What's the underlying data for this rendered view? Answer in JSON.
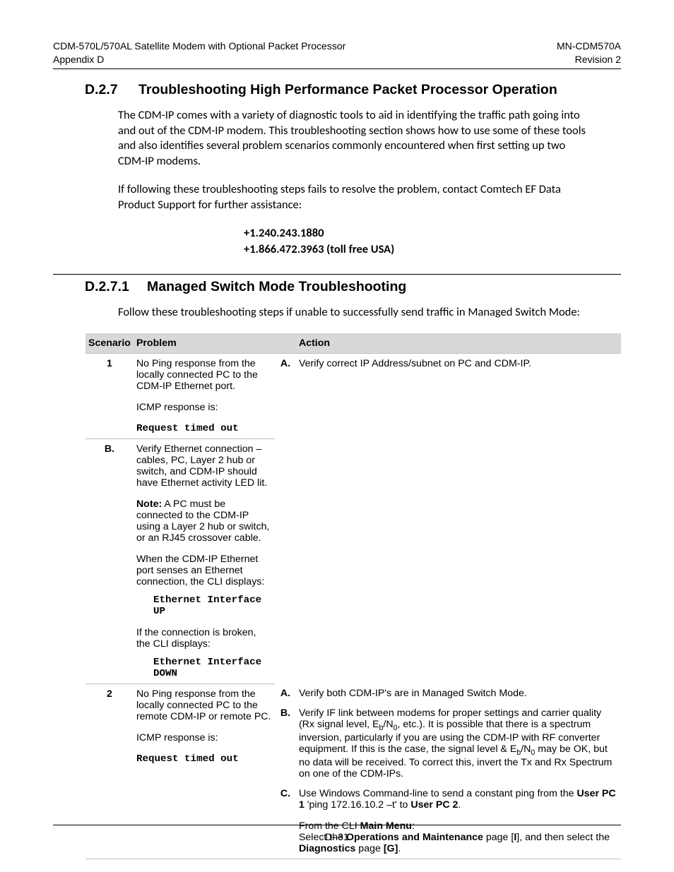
{
  "header": {
    "left_line1": "CDM-570L/570AL Satellite Modem with Optional Packet Processor",
    "left_line2": "Appendix D",
    "right_line1": "MN-CDM570A",
    "right_line2": "Revision 2"
  },
  "section_d27": {
    "num": "D.2.7",
    "title": "Troubleshooting High Performance Packet Processor Operation",
    "p1": "The CDM-IP comes with a variety of diagnostic tools to aid in identifying the traffic path going into and out of the CDM-IP modem. This troubleshooting section shows how to use some of these tools and also identifies several problem scenarios commonly encountered when first setting up two CDM-IP modems.",
    "p2": "If following these troubleshooting steps fails to resolve the problem, contact Comtech EF Data Product Support for further assistance:",
    "phone1": "+1.240.243.1880",
    "phone2": "+1.866.472.3963 (toll free USA)"
  },
  "section_d271": {
    "num": "D.2.7.1",
    "title": "Managed Switch Mode Troubleshooting",
    "p1": "Follow these troubleshooting steps if unable to successfully send traffic in Managed Switch Mode:"
  },
  "table": {
    "headers": {
      "scenario": "Scenario",
      "problem": "Problem",
      "action": "Action"
    },
    "row1": {
      "scenario": "1",
      "problem_l1": "No Ping response from the locally connected PC to the CDM-IP Ethernet port.",
      "problem_l2": "ICMP response is:",
      "problem_code": "Request timed out",
      "a_letter": "A.",
      "a_text": "Verify correct IP Address/subnet on PC and CDM-IP.",
      "b_letter": "B.",
      "b_text": "Verify Ethernet connection – cables, PC, Layer 2 hub or switch, and CDM-IP should have Ethernet activity LED lit.",
      "note_label": "Note:",
      "note_text": " A PC must be connected to the CDM-IP using a Layer 2 hub or switch, or an RJ45 crossover cable.",
      "sense_text": "When the CDM-IP Ethernet port senses an Ethernet connection, the CLI displays:",
      "code_up": "Ethernet Interface UP",
      "broken_text": "If the connection is broken, the CLI displays:",
      "code_down": "Ethernet Interface DOWN"
    },
    "row2": {
      "scenario": "2",
      "problem_l1": "No Ping response from the locally connected PC to the remote CDM-IP or remote PC.",
      "problem_l2": "ICMP response is:",
      "problem_code": "Request timed out",
      "a_letter": "A.",
      "a_text": "Verify both CDM-IP's are in Managed Switch Mode.",
      "b_letter": "B.",
      "c_letter": "C.",
      "c_pre": "Use Windows Command-line to send a constant ping from the ",
      "c_user1": "User PC 1",
      "c_mid": " 'ping 172.16.10.2 –t' to ",
      "c_user2": "User PC 2",
      "c_post": ".",
      "cli_from": "From the CLI ",
      "cli_main": "Main Menu",
      "cli_colon": ":",
      "cli_select": "Select the  ",
      "cli_ops": "Operations and Maintenance",
      "cli_page_i": " page [",
      "cli_i": "I",
      "cli_then": "], and then select the ",
      "cli_diag": "Diagnostics",
      "cli_page_g": " page ",
      "cli_g": "[G]",
      "cli_dot": "."
    }
  },
  "footer": {
    "pagenum": "D–31"
  }
}
